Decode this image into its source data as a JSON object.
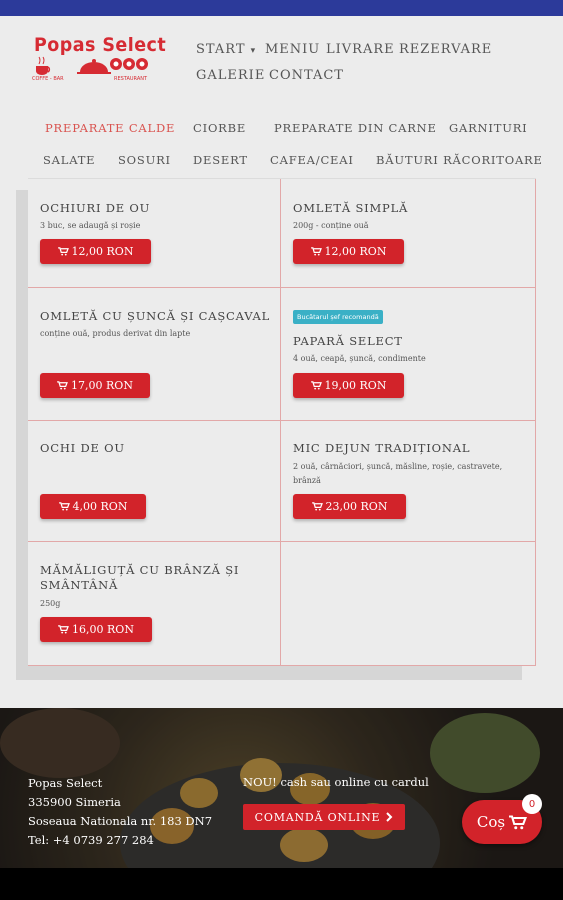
{
  "brand": {
    "name": "Popas Select",
    "sub_left": "COFFE - BAR",
    "sub_right": "RESTAURANT",
    "color": "#d62b33"
  },
  "nav": {
    "items": [
      "START",
      "MENIU",
      "LIVRARE",
      "REZERVARE",
      "GALERIE",
      "CONTACT"
    ],
    "start_caret": "▾"
  },
  "categories": {
    "active": "PREPARATE CALDE",
    "items": [
      "PREPARATE CALDE",
      "CIORBE",
      "PREPARATE DIN CARNE",
      "GARNITURI",
      "SALATE",
      "SOSURI",
      "DESERT",
      "CAFEA/CEAI",
      "BĂUTURI RĂCORITOARE"
    ]
  },
  "menu": [
    {
      "title": "OCHIURI DE OU",
      "desc": "3 buc, se adaugă și roșie",
      "price": "12,00 RON"
    },
    {
      "title": "OMLETĂ SIMPLĂ",
      "desc": "200g - conține ouă",
      "price": "12,00 RON"
    },
    {
      "title": "OMLETĂ CU ȘUNCĂ ȘI CAȘCAVAL",
      "desc": "conține ouă, produs derivat din lapte",
      "price": "17,00 RON"
    },
    {
      "badge": "Bucătarul șef recomandă",
      "title": "PAPARĂ SELECT",
      "desc": "4 ouă, ceapă, șuncă, condimente",
      "price": "19,00 RON"
    },
    {
      "title": "OCHI DE OU",
      "desc": "",
      "price": "4,00 RON"
    },
    {
      "title": "MIC DEJUN TRADIȚIONAL",
      "desc_line1": "2 ouă, cârnăciori, șuncă, măsline, roșie, castravete,",
      "desc_line2": "brânză",
      "price": "23,00 RON"
    },
    {
      "title_line1": "MĂMĂLIGUȚĂ CU BRÂNZĂ ȘI",
      "title_line2": "SMÂNTÂNĂ",
      "desc": "250g",
      "price": "16,00 RON"
    }
  ],
  "footer": {
    "company": "Popas Select",
    "city": "335900 Simeria",
    "address": "Soseaua Nationala nr. 183 DN7",
    "phone": "Tel: +4 0739 277 284",
    "promo": "NOU! cash sau online cu cardul",
    "order_label": "COMANDĂ ONLINE",
    "cart_label": "Coș",
    "cart_count": "0"
  },
  "colors": {
    "accent": "#d2232a",
    "top_bar": "#2c3a9a",
    "badge": "#3ab0c6",
    "background": "#ececec"
  }
}
